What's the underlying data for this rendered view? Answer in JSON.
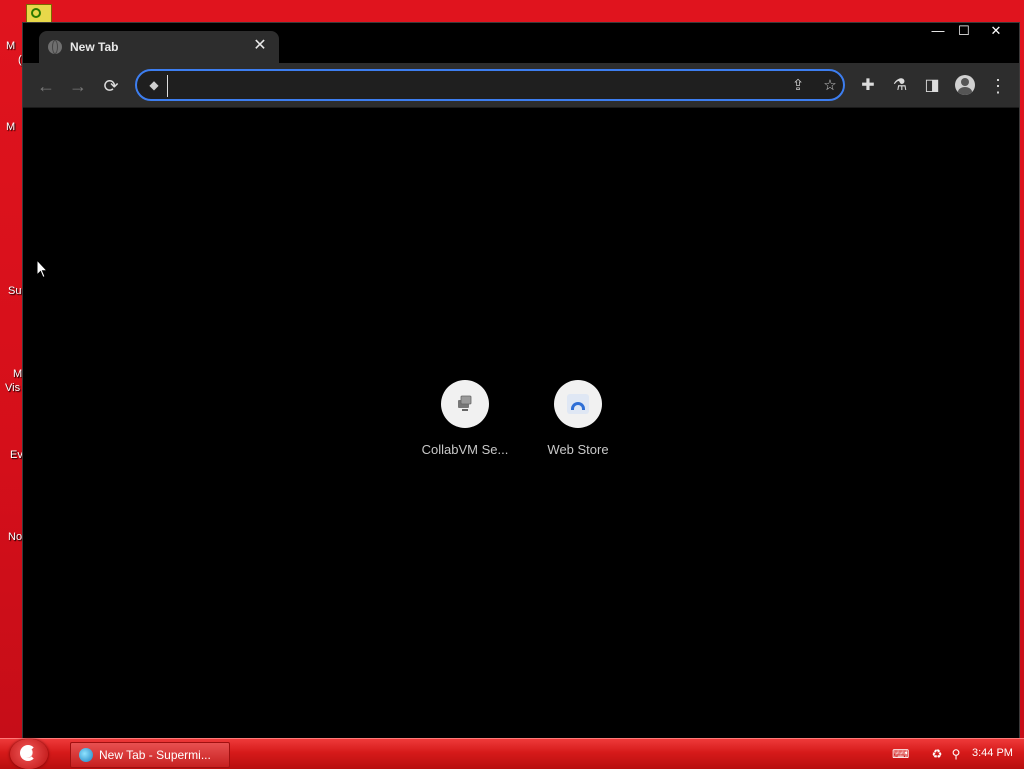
{
  "desktop": {
    "labels": [
      "M",
      "(",
      "M",
      "Su",
      "M",
      "Vis",
      "Ev",
      "No"
    ]
  },
  "browser": {
    "tab_title": "New Tab",
    "tab_close": "✕",
    "window_controls": {
      "minimize": "—",
      "maximize": "☐",
      "close": "✕"
    },
    "toolbar": {
      "back": "←",
      "forward": "→",
      "reload": "⟳",
      "menu": "⋮"
    },
    "omnibox": {
      "value": "",
      "placeholder": ""
    },
    "shortcuts": [
      {
        "label": "CollabVM Se...",
        "icon": "collabvm-icon"
      },
      {
        "label": "Web Store",
        "icon": "webstore-icon"
      }
    ]
  },
  "taskbar": {
    "task_label": "New Tab - Supermi...",
    "clock": "3:44 PM"
  },
  "colors": {
    "desktop_bg": "#d8101c",
    "window_bg": "#000000",
    "toolbar_bg": "#2d2d2d",
    "omnibox_focus": "#3d7ef0",
    "taskbar": "#d61a1a"
  }
}
